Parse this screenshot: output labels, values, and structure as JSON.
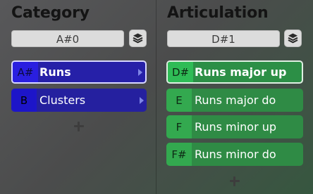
{
  "category": {
    "title": "Category",
    "selector_value": "A#0",
    "stack_icon": "layers-icon",
    "items": [
      {
        "key": "A#",
        "label": "Runs",
        "selected": true
      },
      {
        "key": "B",
        "label": "Clusters",
        "selected": false
      }
    ]
  },
  "articulation": {
    "title": "Articulation",
    "selector_value": "D#1",
    "stack_icon": "layers-icon",
    "items": [
      {
        "key": "D#",
        "label": "Runs major up",
        "selected": true
      },
      {
        "key": "E",
        "label": "Runs major do",
        "selected": false
      },
      {
        "key": "F",
        "label": "Runs minor up",
        "selected": false
      },
      {
        "key": "F#",
        "label": "Runs minor do",
        "selected": false
      }
    ]
  },
  "colors": {
    "category_accent": "#25209f",
    "articulation_accent": "#2f8b45"
  }
}
